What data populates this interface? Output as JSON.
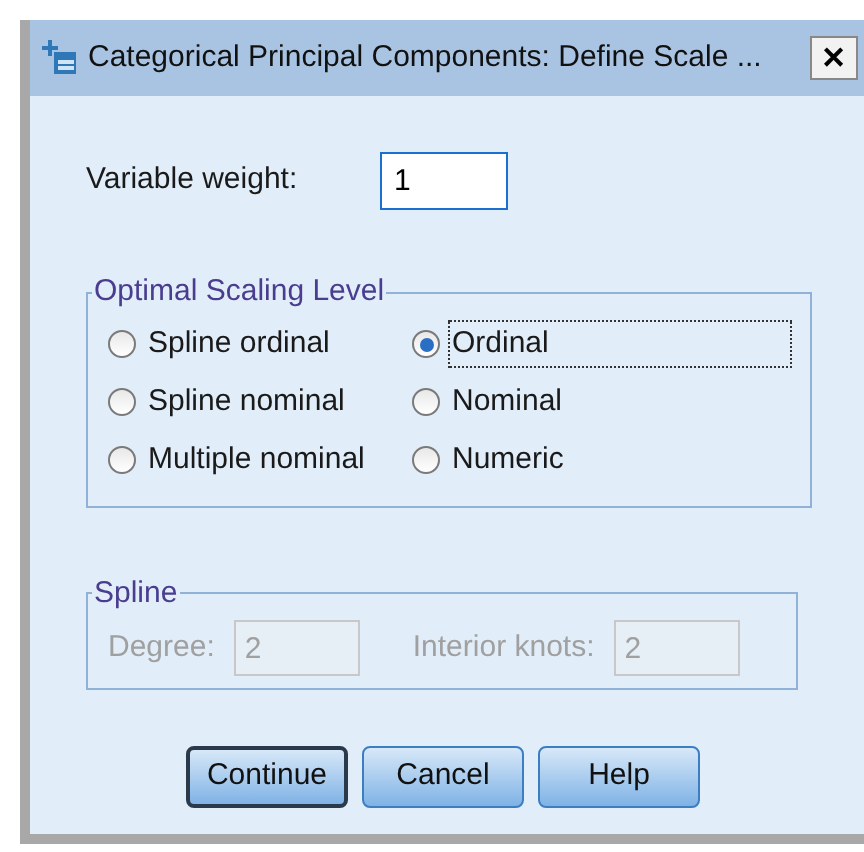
{
  "window": {
    "title": "Categorical Principal Components: Define Scale ...",
    "close": "✕"
  },
  "variable_weight": {
    "label": "Variable weight:",
    "value": "1"
  },
  "scaling_level": {
    "title": "Optimal Scaling Level",
    "options": [
      {
        "label": "Spline ordinal",
        "selected": false,
        "focused": false
      },
      {
        "label": "Ordinal",
        "selected": true,
        "focused": true
      },
      {
        "label": "Spline nominal",
        "selected": false,
        "focused": false
      },
      {
        "label": "Nominal",
        "selected": false,
        "focused": false
      },
      {
        "label": "Multiple nominal",
        "selected": false,
        "focused": false
      },
      {
        "label": "Numeric",
        "selected": false,
        "focused": false
      }
    ]
  },
  "spline": {
    "title": "Spline",
    "disabled": true,
    "degree": {
      "label": "Degree:",
      "value": "2"
    },
    "interior_knots": {
      "label": "Interior knots:",
      "value": "2"
    }
  },
  "buttons": [
    {
      "label": "Continue",
      "default": true
    },
    {
      "label": "Cancel",
      "default": false
    },
    {
      "label": "Help",
      "default": false
    }
  ]
}
